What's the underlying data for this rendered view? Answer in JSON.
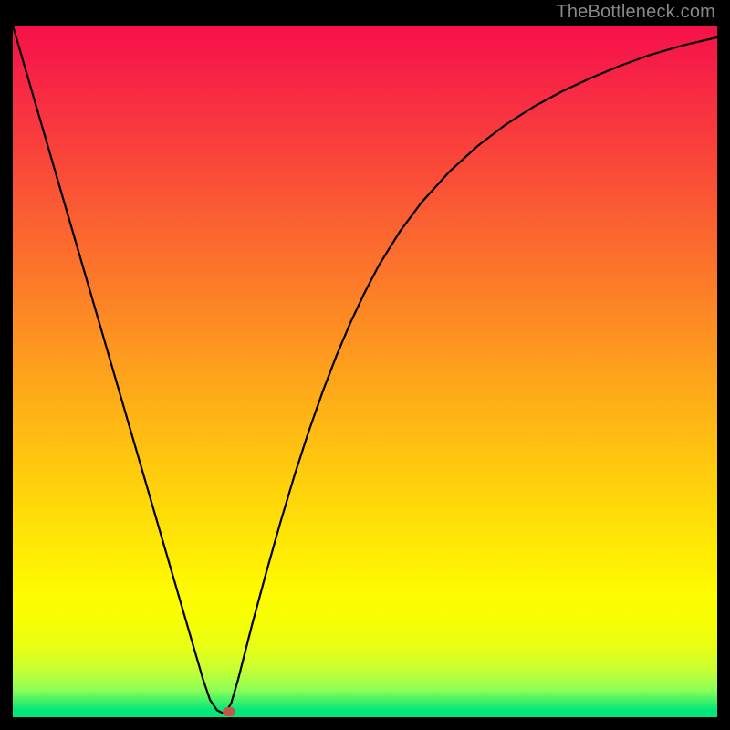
{
  "watermark": "TheBottleneck.com",
  "colors": {
    "frame": "#000000",
    "curve": "#000000",
    "marker": "#C1584A",
    "gradient_top": "#F71148",
    "gradient_bottom": "#00E77A"
  },
  "chart_data": {
    "type": "line",
    "title": "",
    "xlabel": "",
    "ylabel": "",
    "xlim": [
      0,
      100
    ],
    "ylim": [
      0,
      100
    ],
    "series": [
      {
        "name": "bottleneck-curve",
        "x": [
          0,
          2,
          4,
          6,
          8,
          10,
          12,
          14,
          16,
          18,
          20,
          22,
          24,
          26,
          27,
          28,
          29,
          30,
          30.1,
          31,
          32,
          34,
          36,
          38,
          40,
          42,
          44,
          46,
          48,
          50,
          52,
          55,
          58,
          62,
          66,
          70,
          74,
          78,
          82,
          86,
          90,
          95,
          100
        ],
        "y": [
          100,
          93,
          86,
          79,
          72,
          65,
          58,
          51,
          44,
          37,
          30,
          23,
          16,
          9,
          5.5,
          2.5,
          1,
          0.5,
          0.5,
          2,
          5.5,
          13.5,
          21,
          28.2,
          35,
          41.3,
          47.1,
          52.4,
          57.2,
          61.5,
          65.4,
          70.3,
          74.4,
          78.9,
          82.6,
          85.7,
          88.3,
          90.5,
          92.4,
          94.1,
          95.6,
          97.1,
          98.3
        ],
        "note": "Two-branch curve meeting at minimum near x≈30, y≈0. Left branch near-linear, right branch concave sqrt-like."
      }
    ],
    "marker": {
      "x": 30.7,
      "y": 0.8
    },
    "grid": false,
    "legend": false
  }
}
